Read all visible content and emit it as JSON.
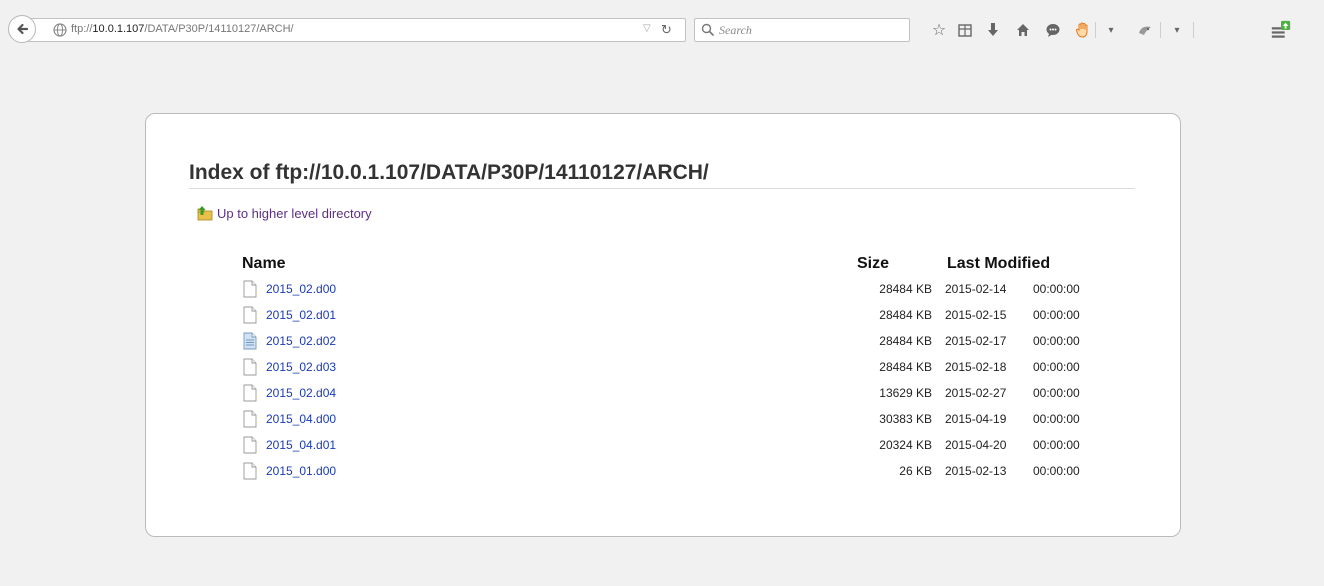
{
  "browser": {
    "url_prefix": "ftp://",
    "url_host": "10.0.1.107",
    "url_path": "/DATA/P30P/14110127/ARCH/",
    "search_placeholder": "Search"
  },
  "listing": {
    "title": "Index of ftp://10.0.1.107/DATA/P30P/14110127/ARCH/",
    "up_link": "Up to higher level directory",
    "columns": {
      "name": "Name",
      "size": "Size",
      "modified": "Last Modified"
    },
    "files": [
      {
        "name": "2015_02.d00",
        "size": "28484 KB",
        "date": "2015-02-14",
        "time": "00:00:00",
        "icon": "file-icon"
      },
      {
        "name": "2015_02.d01",
        "size": "28484 KB",
        "date": "2015-02-15",
        "time": "00:00:00",
        "icon": "file-icon"
      },
      {
        "name": "2015_02.d02",
        "size": "28484 KB",
        "date": "2015-02-17",
        "time": "00:00:00",
        "icon": "text-file-icon"
      },
      {
        "name": "2015_02.d03",
        "size": "28484 KB",
        "date": "2015-02-18",
        "time": "00:00:00",
        "icon": "file-icon"
      },
      {
        "name": "2015_02.d04",
        "size": "13629 KB",
        "date": "2015-02-27",
        "time": "00:00:00",
        "icon": "file-icon"
      },
      {
        "name": "2015_04.d00",
        "size": "30383 KB",
        "date": "2015-04-19",
        "time": "00:00:00",
        "icon": "file-icon"
      },
      {
        "name": "2015_04.d01",
        "size": "20324 KB",
        "date": "2015-04-20",
        "time": "00:00:00",
        "icon": "file-icon"
      },
      {
        "name": "2015_01.d00",
        "size": "26 KB",
        "date": "2015-02-13",
        "time": "00:00:00",
        "icon": "file-icon"
      }
    ]
  },
  "colors": {
    "link": "#1a3bb5",
    "visited": "#5c2f86",
    "background": "#f1f1f1"
  }
}
